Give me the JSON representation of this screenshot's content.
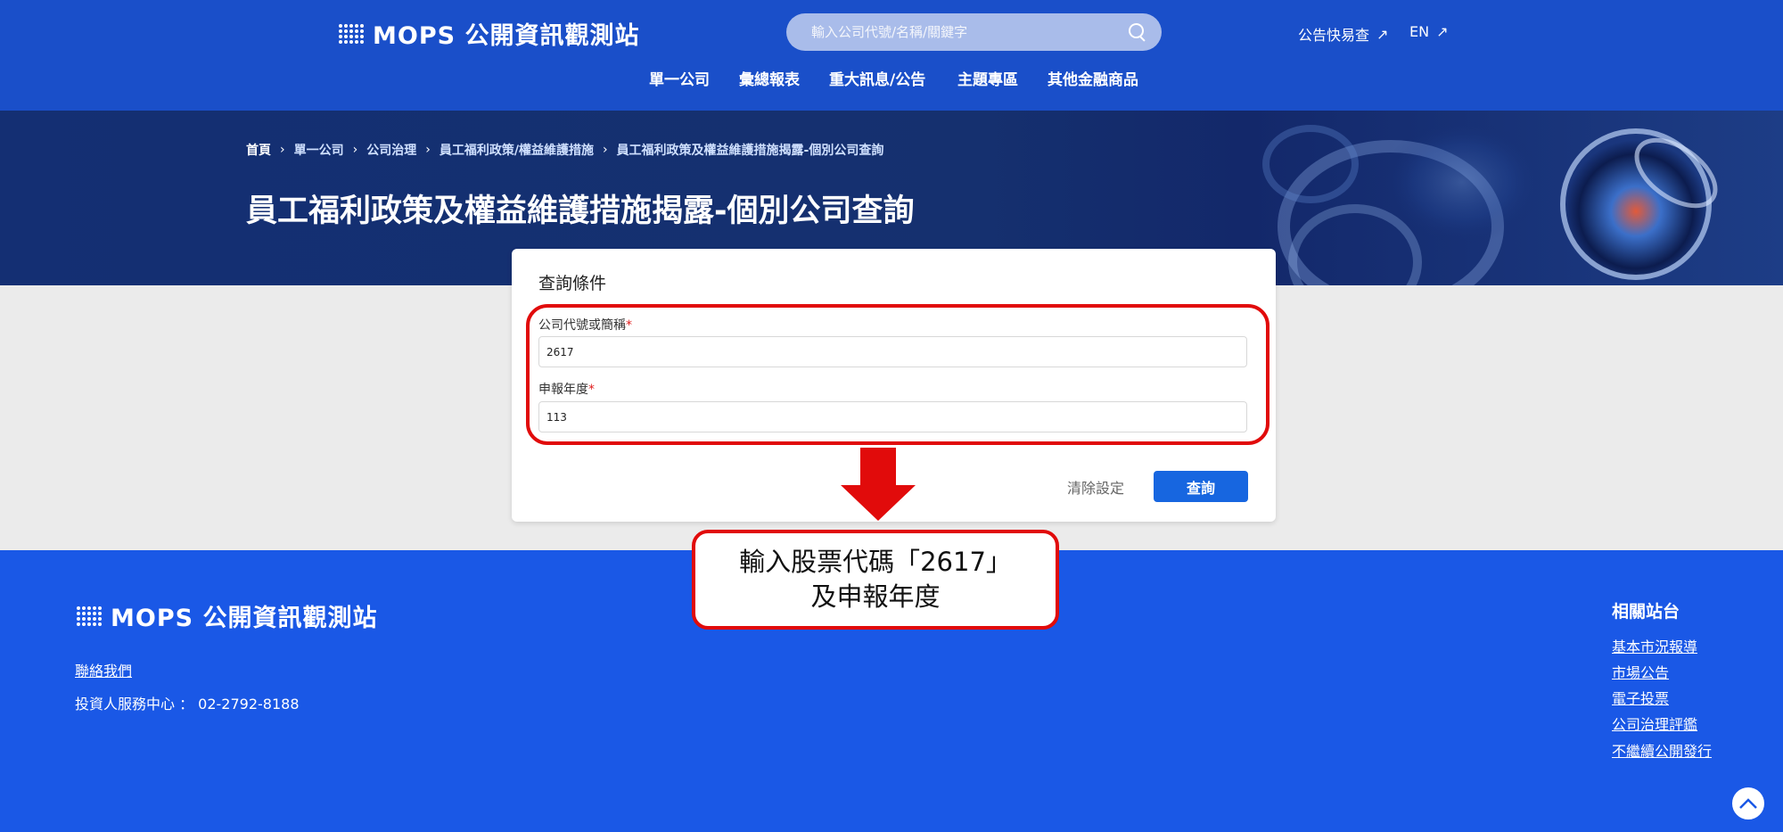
{
  "header": {
    "logo_text": "MOPS 公開資訊觀測站",
    "search_placeholder": "輸入公司代號/名稱/關鍵字",
    "quick_lookup": "公告快易查",
    "language": "EN",
    "nav": [
      "單一公司",
      "彙總報表",
      "重大訊息/公告",
      "主題專區",
      "其他金融商品"
    ]
  },
  "breadcrumb": [
    "首頁",
    "單一公司",
    "公司治理",
    "員工福利政策/權益維護措施",
    "員工福利政策及權益維護措施揭露-個別公司查詢"
  ],
  "page_title": "員工福利政策及權益維護措施揭露-個別公司查詢",
  "query_form": {
    "title": "查詢條件",
    "company_label": "公司代號或簡稱",
    "company_value": "2617",
    "year_label": "申報年度",
    "year_value": "113",
    "required_mark": "*",
    "clear_label": "清除設定",
    "submit_label": "查詢"
  },
  "callout": {
    "line1": "輸入股票代碼「2617」",
    "line2": "及申報年度"
  },
  "footer": {
    "logo_text": "MOPS 公開資訊觀測站",
    "contact_link": "聯絡我們",
    "service_text": "投資人服務中心 ： 02-2792-8188",
    "related_title": "相關站台",
    "related_links": [
      "基本市況報導",
      "市場公告",
      "電子投票",
      "公司治理評鑑",
      "不繼續公開發行"
    ]
  },
  "colors": {
    "header_bg": "#1a4fc9",
    "footer_bg": "#1a58e6",
    "accent_button": "#1766e0",
    "highlight_red": "#e10b0b"
  }
}
